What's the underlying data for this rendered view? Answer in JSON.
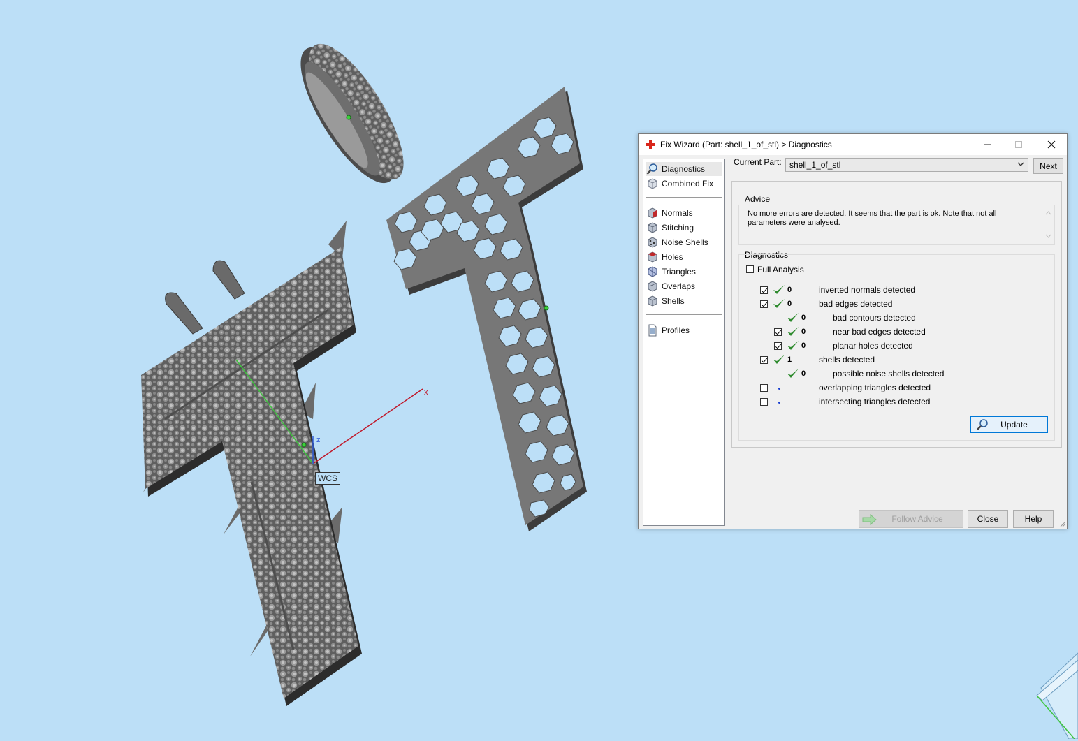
{
  "viewport": {
    "background": "#bcdff7",
    "vcs_label": "WCS",
    "axis_x_label": "x",
    "axis_z_label": "z"
  },
  "dialog": {
    "title": "Fix Wizard (Part: shell_1_of_stl) > Diagnostics",
    "minimize_icon": "minimize-icon",
    "maximize_icon": "maximize-icon",
    "close_icon": "close-icon",
    "nav": {
      "top_items": [
        {
          "label": "Diagnostics",
          "icon": "magnifier-icon",
          "selected": true
        },
        {
          "label": "Combined Fix",
          "icon": "cube-icon"
        }
      ],
      "tool_items": [
        {
          "label": "Normals",
          "icon": "normals-cube-icon"
        },
        {
          "label": "Stitching",
          "icon": "stitching-cube-icon"
        },
        {
          "label": "Noise Shells",
          "icon": "noise-shells-icon"
        },
        {
          "label": "Holes",
          "icon": "holes-cube-icon"
        },
        {
          "label": "Triangles",
          "icon": "triangles-cube-icon"
        },
        {
          "label": "Overlaps",
          "icon": "overlaps-cube-icon"
        },
        {
          "label": "Shells",
          "icon": "shells-cube-icon"
        }
      ],
      "bottom_items": [
        {
          "label": "Profiles",
          "icon": "document-icon"
        }
      ]
    },
    "current_part_label": "Current Part:",
    "current_part_value": "shell_1_of_stl",
    "next_label": "Next",
    "advice": {
      "title": "Advice",
      "text": "No more errors are detected. It seems that the part is ok. Note that not all parameters were analysed."
    },
    "diagnostics": {
      "title": "Diagnostics",
      "full_analysis_label": "Full Analysis",
      "full_analysis_checked": false,
      "rows": [
        {
          "label": "inverted normals detected",
          "value": "0",
          "checked": true,
          "status": "ok",
          "indent": 0
        },
        {
          "label": "bad edges detected",
          "value": "0",
          "checked": true,
          "status": "ok",
          "indent": 0
        },
        {
          "label": "bad contours detected",
          "value": "0",
          "checked": null,
          "status": "ok",
          "indent": 1
        },
        {
          "label": "near bad edges detected",
          "value": "0",
          "checked": true,
          "status": "ok",
          "indent": 1
        },
        {
          "label": "planar holes detected",
          "value": "0",
          "checked": true,
          "status": "ok",
          "indent": 1
        },
        {
          "label": "shells detected",
          "value": "1",
          "checked": true,
          "status": "ok",
          "indent": 0
        },
        {
          "label": "possible noise shells detected",
          "value": "0",
          "checked": null,
          "status": "ok",
          "indent": 1
        },
        {
          "label": "overlapping triangles detected",
          "value": "",
          "checked": false,
          "status": "none",
          "indent": 0
        },
        {
          "label": "intersecting triangles detected",
          "value": "",
          "checked": false,
          "status": "none",
          "indent": 0
        }
      ],
      "update_label": "Update"
    },
    "follow_advice_label": "Follow Advice",
    "close_label": "Close",
    "help_label": "Help"
  },
  "colors": {
    "checkmark_green": "#2e8b2e",
    "accent_blue": "#0078d7",
    "title_icon_red": "#d9261c"
  }
}
